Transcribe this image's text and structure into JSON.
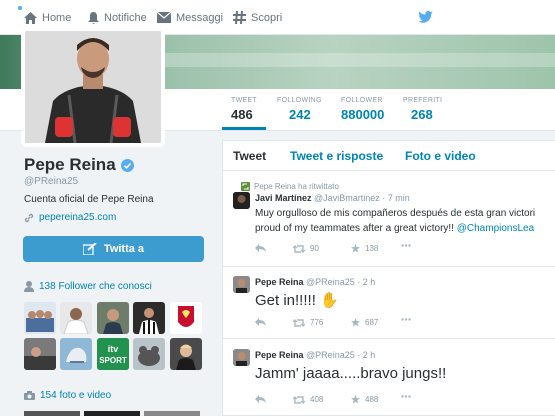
{
  "nav": {
    "home": "Home",
    "notifications": "Notifiche",
    "messages": "Messaggi",
    "discover": "Scopri"
  },
  "stats": [
    {
      "label": "TWEET",
      "value": "486"
    },
    {
      "label": "FOLLOWING",
      "value": "242"
    },
    {
      "label": "FOLLOWER",
      "value": "880000"
    },
    {
      "label": "PREFERITI",
      "value": "268"
    }
  ],
  "profile": {
    "name": "Pepe Reina",
    "handle": "@PReina25",
    "bio": "Cuenta oficial de Pepe Reina",
    "website": "pepereina25.com",
    "tweet_to_button": "Twitta a",
    "followers_you_know": "138 Follower che conosci",
    "photos_videos": "154 foto e video",
    "thumb_labels": {
      "itv": "itv",
      "sport": "SPORT"
    }
  },
  "tabs": [
    "Tweet",
    "Tweet e risposte",
    "Foto e video"
  ],
  "tweets": [
    {
      "retweet_note": "Pepe Reina ha ritwittato",
      "name": "Javi Martínez",
      "meta": "@JaviBmartinez · 7 min",
      "text_line1": "Muy orgulloso de mis compañeros después de esta gran victori",
      "text_line2_plain": "proud of my teammates after a great victory!! ",
      "text_line2_link": "@ChampionsLea",
      "retweets": "90",
      "favorites": "138"
    },
    {
      "name": "Pepe Reina",
      "meta": "@PReina25 · 2 h",
      "text": "Get in!!!!! ✋",
      "retweets": "776",
      "favorites": "687"
    },
    {
      "name": "Pepe Reina",
      "meta": "@PReina25 · 2 h",
      "text": "Jamm' jaaaa.....bravo jungs!!",
      "retweets": "408",
      "favorites": "488"
    }
  ],
  "colors": {
    "link": "#0084b4",
    "button": "#3d9ccf",
    "muted": "#8899a6"
  }
}
